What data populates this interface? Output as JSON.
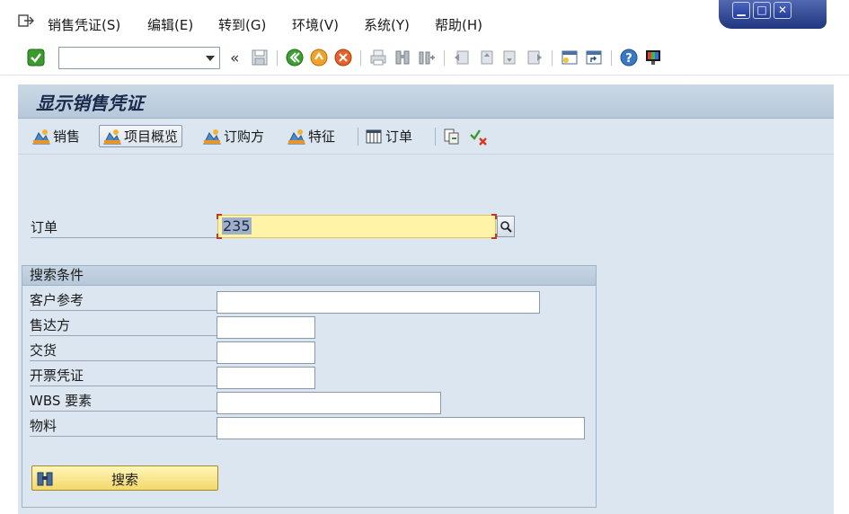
{
  "menu": {
    "icon": "exit-menu-icon",
    "items": [
      {
        "label": "销售凭证(S)"
      },
      {
        "label": "编辑(E)"
      },
      {
        "label": "转到(G)"
      },
      {
        "label": "环境(V)"
      },
      {
        "label": "系统(Y)"
      },
      {
        "label": "帮助(H)"
      }
    ]
  },
  "window_controls": {
    "minimize": "▁",
    "maximize": "□",
    "close": "✕"
  },
  "toolbar": {
    "command_field": {
      "value": "",
      "placeholder": ""
    },
    "back_chevron": "«"
  },
  "title": "显示销售凭证",
  "app_toolbar": {
    "sales": "销售",
    "item_overview": "项目概览",
    "ordering_party": "订购方",
    "characteristics": "特征",
    "order": "订单"
  },
  "order_field": {
    "label": "订单",
    "value": "235"
  },
  "search_criteria": {
    "title": "搜索条件",
    "fields": [
      {
        "label": "客户参考",
        "value": ""
      },
      {
        "label": "售达方",
        "value": ""
      },
      {
        "label": "交货",
        "value": ""
      },
      {
        "label": "开票凭证",
        "value": ""
      },
      {
        "label": "WBS 要素",
        "value": ""
      },
      {
        "label": "物料",
        "value": ""
      }
    ],
    "search_button": "搜索"
  },
  "colors": {
    "title_bg": "#c3d3e3",
    "content_bg": "#dbe6f0",
    "highlight_input": "#fff3a8",
    "window_controls": "#2a4290"
  }
}
